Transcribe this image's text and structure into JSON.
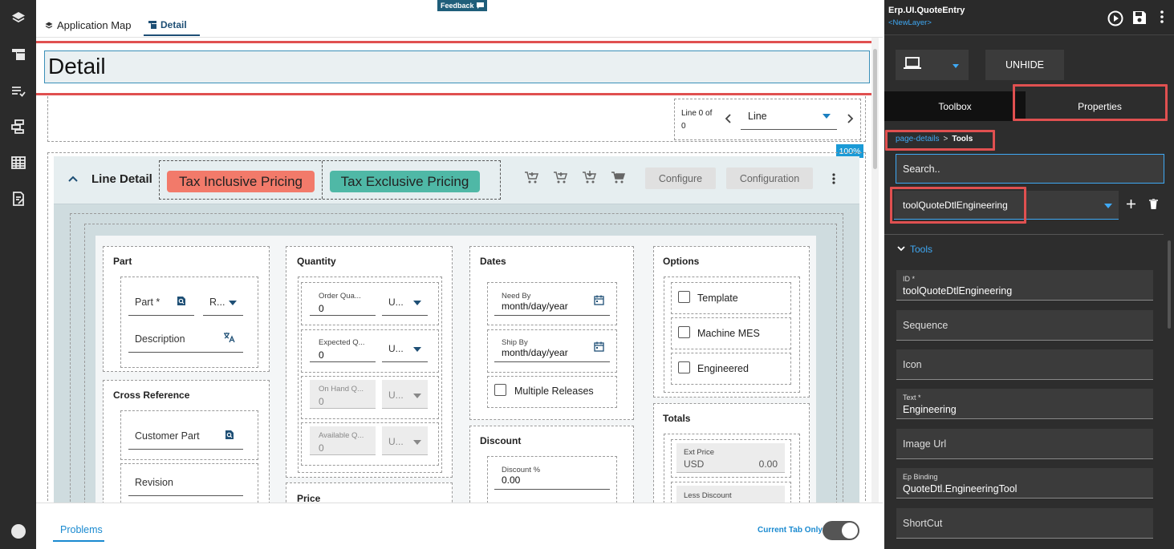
{
  "top_tabs": {
    "app_map": "Application Map",
    "detail": "Detail"
  },
  "feedback": "Feedback",
  "page_title": "Detail",
  "line_nav": {
    "line_of": "Line 0 of",
    "line_count": "0",
    "select_value": "Line"
  },
  "zoom": "100%",
  "line_detail": {
    "title": "Line Detail",
    "tax_inclusive": "Tax Inclusive Pricing",
    "tax_exclusive": "Tax Exclusive Pricing",
    "configure": "Configure",
    "configuration": "Configuration"
  },
  "part": {
    "title": "Part",
    "part_label": "Part *",
    "rev_label": "R...",
    "description_label": "Description"
  },
  "cross_ref": {
    "title": "Cross Reference",
    "customer_part": "Customer Part",
    "revision": "Revision"
  },
  "quantity": {
    "title": "Quantity",
    "rows": [
      {
        "label": "Order Qua...",
        "value": "0",
        "uom": "U..."
      },
      {
        "label": "Expected Q...",
        "value": "0",
        "uom": "U..."
      },
      {
        "label": "On Hand Q...",
        "value": "0",
        "uom": "U..."
      },
      {
        "label": "Available Q...",
        "value": "0",
        "uom": "U..."
      }
    ]
  },
  "price": {
    "title": "Price"
  },
  "dates": {
    "title": "Dates",
    "need_by_label": "Need By",
    "need_by_value": "month/day/year",
    "ship_by_label": "Ship By",
    "ship_by_value": "month/day/year",
    "multiple_releases": "Multiple Releases"
  },
  "discount": {
    "title": "Discount",
    "pct_label": "Discount %",
    "pct_value": "0.00"
  },
  "options": {
    "title": "Options",
    "template": "Template",
    "machine_mes": "Machine MES",
    "engineered": "Engineered"
  },
  "totals": {
    "title": "Totals",
    "ext_price_label": "Ext Price",
    "currency": "USD",
    "ext_price_value": "0.00",
    "less_discount_label": "Less Discount"
  },
  "bottom": {
    "problems": "Problems",
    "current_tab_only": "Current Tab Only"
  },
  "right_panel": {
    "app_title": "Erp.UI.QuoteEntry",
    "layer": "<NewLayer>",
    "unhide": "UNHIDE",
    "tab_toolbox": "Toolbox",
    "tab_properties": "Properties",
    "breadcrumb_link": "page-details",
    "breadcrumb_sep": ">",
    "breadcrumb_current": "Tools",
    "search_placeholder": "Search..",
    "tool_select": "toolQuoteDtlEngineering",
    "tools_section": "Tools",
    "fields": {
      "id_label": "ID *",
      "id_value": "toolQuoteDtlEngineering",
      "sequence": "Sequence",
      "icon": "Icon",
      "text_label": "Text *",
      "text_value": "Engineering",
      "image_url": "Image Url",
      "ep_binding_label": "Ep Binding",
      "ep_binding_value": "QuoteDtl.EngineeringTool",
      "shortcut": "ShortCut"
    }
  },
  "colors": {
    "tax_inclusive": "#f27a6a",
    "tax_exclusive": "#4fb8a6",
    "accent": "#1a9ad6",
    "highlight": "#e05050"
  }
}
